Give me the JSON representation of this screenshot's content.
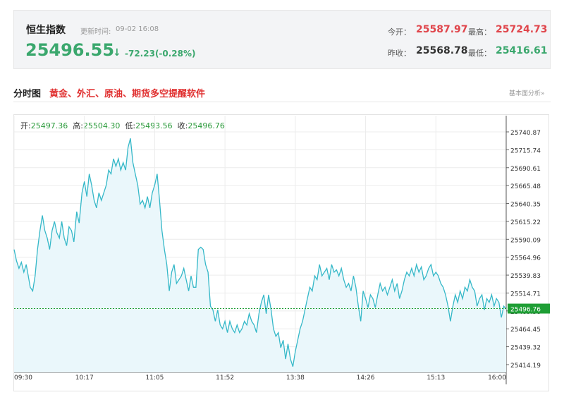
{
  "header": {
    "name": "恒生指数",
    "update_label": "更新时间:",
    "update_time": "09-02 16:08",
    "price": "25496.55",
    "arrow": "↓",
    "change": "-72.23(-0.28%)",
    "open_label": "今开：",
    "open": "25587.97",
    "high_label": "最高：",
    "high": "25724.73",
    "prev_close_label": "昨收：",
    "prev_close": "25568.78",
    "low_label": "最低：",
    "low": "25416.61"
  },
  "section": {
    "title": "分时图",
    "promo": "黄金、外汇、原油、期货多空提醒软件",
    "tech_link": "基本面分析»"
  },
  "ohlc": {
    "open_label": "开:",
    "open": "25497.36",
    "high_label": "高:",
    "high": "25504.30",
    "low_label": "低:",
    "low": "25493.56",
    "close_label": "收:",
    "close": "25496.76"
  },
  "colors": {
    "up": "#e0454b",
    "down": "#3aa76d",
    "line": "#35b8c8",
    "fill": "#eaf7fb",
    "current_tag": "#1e9e35"
  },
  "chart_data": {
    "type": "area",
    "x_ticks": [
      "09:30",
      "10:17",
      "11:05",
      "11:52",
      "13:38",
      "14:26",
      "15:13",
      "16:00"
    ],
    "y_ticks": [
      "25740.87",
      "25715.74",
      "25690.61",
      "25665.48",
      "25640.35",
      "25615.22",
      "25590.09",
      "25564.96",
      "25539.83",
      "25514.71",
      "25489.58",
      "25464.45",
      "25439.32",
      "25414.19"
    ],
    "ylim": [
      25414.19,
      25740.87
    ],
    "current_price": 25496.76,
    "current_label": "25496.76",
    "xlim": [
      0,
      100
    ],
    "points": [
      [
        0,
        25575
      ],
      [
        0.6,
        25560
      ],
      [
        1.2,
        25550
      ],
      [
        1.8,
        25558
      ],
      [
        2.4,
        25545
      ],
      [
        3,
        25555
      ],
      [
        3.5,
        25540
      ],
      [
        4,
        25525
      ],
      [
        4.6,
        25520
      ],
      [
        5.2,
        25540
      ],
      [
        5.8,
        25575
      ],
      [
        6.4,
        25600
      ],
      [
        7,
        25620
      ],
      [
        7.6,
        25600
      ],
      [
        8.2,
        25590
      ],
      [
        8.8,
        25575
      ],
      [
        9.4,
        25600
      ],
      [
        10,
        25612
      ],
      [
        10.6,
        25597
      ],
      [
        11.2,
        25590
      ],
      [
        11.8,
        25612
      ],
      [
        12.4,
        25590
      ],
      [
        13,
        25580
      ],
      [
        13.6,
        25605
      ],
      [
        14.2,
        25600
      ],
      [
        14.8,
        25585
      ],
      [
        15.5,
        25625
      ],
      [
        16.1,
        25610
      ],
      [
        16.8,
        25650
      ],
      [
        17.4,
        25665
      ],
      [
        18,
        25645
      ],
      [
        18.6,
        25675
      ],
      [
        19.2,
        25660
      ],
      [
        19.8,
        25640
      ],
      [
        20.4,
        25630
      ],
      [
        21,
        25650
      ],
      [
        21.6,
        25640
      ],
      [
        22.2,
        25650
      ],
      [
        22.8,
        25660
      ],
      [
        23.4,
        25680
      ],
      [
        24,
        25675
      ],
      [
        24.6,
        25695
      ],
      [
        25.2,
        25685
      ],
      [
        25.8,
        25695
      ],
      [
        26.4,
        25680
      ],
      [
        27,
        25690
      ],
      [
        27.6,
        25680
      ],
      [
        28.2,
        25710
      ],
      [
        28.8,
        25722
      ],
      [
        29.4,
        25690
      ],
      [
        30,
        25675
      ],
      [
        30.6,
        25660
      ],
      [
        31.2,
        25635
      ],
      [
        31.8,
        25640
      ],
      [
        32.4,
        25630
      ],
      [
        33,
        25645
      ],
      [
        33.6,
        25630
      ],
      [
        34.2,
        25650
      ],
      [
        34.8,
        25660
      ],
      [
        35.4,
        25675
      ],
      [
        36,
        25640
      ],
      [
        36.6,
        25600
      ],
      [
        37.2,
        25575
      ],
      [
        37.8,
        25555
      ],
      [
        38.4,
        25520
      ],
      [
        39,
        25545
      ],
      [
        39.6,
        25555
      ],
      [
        40.2,
        25530
      ],
      [
        40.8,
        25535
      ],
      [
        41.4,
        25540
      ],
      [
        42,
        25550
      ],
      [
        42.6,
        25535
      ],
      [
        43.2,
        25520
      ],
      [
        43.8,
        25540
      ],
      [
        44.4,
        25525
      ],
      [
        45,
        25525
      ],
      [
        45.6,
        25575
      ],
      [
        46.2,
        25578
      ],
      [
        46.8,
        25575
      ],
      [
        47.4,
        25555
      ],
      [
        48,
        25545
      ],
      [
        48.6,
        25500
      ],
      [
        49.2,
        25495
      ],
      [
        49.8,
        25480
      ],
      [
        50.4,
        25495
      ],
      [
        51,
        25475
      ],
      [
        51.6,
        25470
      ],
      [
        52.2,
        25480
      ],
      [
        52.8,
        25465
      ],
      [
        53.4,
        25480
      ],
      [
        54,
        25470
      ],
      [
        54.6,
        25465
      ],
      [
        55.2,
        25475
      ],
      [
        55.8,
        25465
      ],
      [
        56.4,
        25470
      ],
      [
        57,
        25480
      ],
      [
        57.6,
        25475
      ],
      [
        58.2,
        25490
      ],
      [
        58.8,
        25480
      ],
      [
        59.4,
        25475
      ],
      [
        60,
        25465
      ],
      [
        60.6,
        25490
      ],
      [
        61.2,
        25505
      ],
      [
        61.8,
        25515
      ],
      [
        62.4,
        25490
      ],
      [
        63,
        25515
      ],
      [
        63.6,
        25495
      ],
      [
        64.2,
        25470
      ],
      [
        64.8,
        25460
      ],
      [
        65.4,
        25465
      ],
      [
        66,
        25445
      ],
      [
        66.6,
        25455
      ],
      [
        67.2,
        25430
      ],
      [
        67.8,
        25450
      ],
      [
        68.4,
        25430
      ],
      [
        69,
        25420
      ],
      [
        69.6,
        25440
      ],
      [
        70.2,
        25455
      ],
      [
        70.8,
        25470
      ],
      [
        71.4,
        25480
      ],
      [
        72,
        25495
      ],
      [
        72.6,
        25510
      ],
      [
        73.2,
        25525
      ],
      [
        73.8,
        25520
      ],
      [
        74.4,
        25540
      ],
      [
        75,
        25535
      ],
      [
        75.6,
        25555
      ],
      [
        76.2,
        25540
      ],
      [
        76.8,
        25545
      ],
      [
        77.4,
        25550
      ],
      [
        78,
        25535
      ],
      [
        78.6,
        25555
      ],
      [
        79.2,
        25545
      ],
      [
        79.8,
        25548
      ],
      [
        80.4,
        25540
      ],
      [
        81,
        25550
      ],
      [
        81.6,
        25535
      ],
      [
        82.2,
        25525
      ],
      [
        82.8,
        25530
      ],
      [
        83.4,
        25520
      ],
      [
        84,
        25540
      ],
      [
        84.6,
        25525
      ],
      [
        85.2,
        25500
      ],
      [
        85.8,
        25480
      ],
      [
        86.4,
        25520
      ],
      [
        87,
        25510
      ],
      [
        87.6,
        25498
      ],
      [
        88.2,
        25515
      ],
      [
        88.8,
        25510
      ],
      [
        89.4,
        25498
      ],
      [
        90,
        25515
      ],
      [
        90.6,
        25530
      ],
      [
        91.2,
        25520
      ],
      [
        91.8,
        25525
      ],
      [
        92.4,
        25515
      ],
      [
        93,
        25525
      ],
      [
        93.6,
        25535
      ],
      [
        94.2,
        25520
      ],
      [
        94.8,
        25530
      ],
      [
        95.4,
        25510
      ],
      [
        96,
        25520
      ],
      [
        96.6,
        25535
      ],
      [
        97.2,
        25545
      ],
      [
        97.8,
        25540
      ],
      [
        98.4,
        25550
      ],
      [
        99,
        25540
      ],
      [
        99.6,
        25555
      ],
      [
        100.2,
        25545
      ],
      [
        100.8,
        25552
      ],
      [
        101.4,
        25535
      ],
      [
        102,
        25540
      ],
      [
        102.6,
        25550
      ],
      [
        103.2,
        25555
      ],
      [
        103.8,
        25540
      ],
      [
        104.4,
        25545
      ],
      [
        105,
        25540
      ],
      [
        105.6,
        25530
      ],
      [
        106.2,
        25525
      ],
      [
        106.8,
        25515
      ],
      [
        107.4,
        25500
      ],
      [
        108,
        25480
      ],
      [
        108.6,
        25500
      ],
      [
        109.2,
        25515
      ],
      [
        109.8,
        25505
      ],
      [
        110.4,
        25520
      ],
      [
        111,
        25510
      ],
      [
        111.6,
        25525
      ],
      [
        112.2,
        25520
      ],
      [
        112.8,
        25535
      ],
      [
        113.4,
        25525
      ],
      [
        114,
        25520
      ],
      [
        114.6,
        25500
      ],
      [
        115.2,
        25510
      ],
      [
        115.8,
        25515
      ],
      [
        116.4,
        25495
      ],
      [
        117,
        25510
      ],
      [
        117.6,
        25505
      ],
      [
        118.2,
        25515
      ],
      [
        118.8,
        25500
      ],
      [
        119.4,
        25510
      ],
      [
        120,
        25505
      ],
      [
        120.6,
        25485
      ],
      [
        121.2,
        25500
      ],
      [
        121.8,
        25496
      ]
    ]
  }
}
